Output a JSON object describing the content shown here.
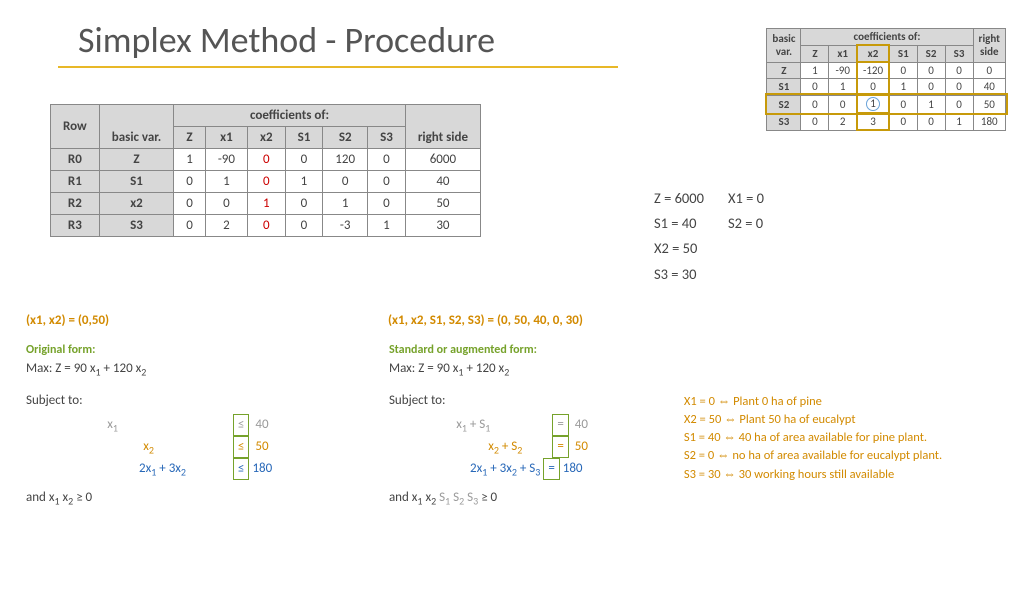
{
  "title": "Simplex Method - Procedure",
  "top_table": {
    "corner1": "basic",
    "corner2": "var.",
    "coeff_hdr": "coefficients of:",
    "right_hdr1": "right",
    "right_hdr2": "side",
    "cols": [
      "Z",
      "x1",
      "x2",
      "S1",
      "S2",
      "S3"
    ],
    "rows": [
      {
        "bv": "Z",
        "c": [
          "1",
          "-90",
          "-120",
          "0",
          "0",
          "0"
        ],
        "r": "0"
      },
      {
        "bv": "S1",
        "c": [
          "0",
          "1",
          "0",
          "1",
          "0",
          "0"
        ],
        "r": "40"
      },
      {
        "bv": "S2",
        "c": [
          "0",
          "0",
          "1",
          "0",
          "1",
          "0"
        ],
        "r": "50"
      },
      {
        "bv": "S3",
        "c": [
          "0",
          "2",
          "3",
          "0",
          "0",
          "1"
        ],
        "r": "180"
      }
    ]
  },
  "main_table": {
    "row_hdr": "Row",
    "bv_hdr": "basic var.",
    "coeff_hdr": "coefficients of:",
    "right_hdr": "right side",
    "cols": [
      "Z",
      "x1",
      "x2",
      "S1",
      "S2",
      "S3"
    ],
    "rows": [
      {
        "row": "R0",
        "bv": "Z",
        "c": [
          "1",
          "-90",
          "0",
          "0",
          "120",
          "0"
        ],
        "r": "6000"
      },
      {
        "row": "R1",
        "bv": "S1",
        "c": [
          "0",
          "1",
          "0",
          "1",
          "0",
          "0"
        ],
        "r": "40"
      },
      {
        "row": "R2",
        "bv": "x2",
        "c": [
          "0",
          "0",
          "1",
          "0",
          "1",
          "0"
        ],
        "r": "50"
      },
      {
        "row": "R3",
        "bv": "S3",
        "c": [
          "0",
          "2",
          "0",
          "0",
          "-3",
          "1"
        ],
        "r": "30"
      }
    ]
  },
  "vals": {
    "z": "Z = 6000",
    "x1": "X1 = 0",
    "s1": "S1 = 40",
    "s2": "S2 = 0",
    "x2": "X2 = 50",
    "s3": "S3 = 30"
  },
  "pt1": "(x1, x2) = (0,50)",
  "pt2": "(x1, x2, S1, S2, S3) = (0, 50, 40, 0, 30)",
  "orig": {
    "title": "Original form:",
    "max": "Max:    Z = 90 x",
    "x1": "1",
    "plus": " + 120 x",
    "x2": "2",
    "subj": "Subject to:",
    "r1a": "x",
    "r1b": "1",
    "r1c": "≤",
    "r1d": "40",
    "r2a": "x",
    "r2b": "2",
    "r2c": "≤",
    "r2d": "50",
    "r3a": "2x",
    "r3b": "1",
    "r3c": " + 3x",
    "r3d": "2",
    "r3e": "≤",
    "r3f": "180",
    "nn": "and         x",
    "n1": "1",
    "sp": "   x",
    "n2": "2",
    "ge": "                  ≥ 0"
  },
  "std": {
    "title": "Standard or augmented form:",
    "max": "Max:    Z = 90 x",
    "x1": "1",
    "plus": " + 120 x",
    "x2": "2",
    "subj": "Subject to:",
    "r1a": "x",
    "r1b": "1",
    "r1c": "     + S",
    "r1d": "1",
    "r1e": "=",
    "r1f": "40",
    "r2a": "x",
    "r2b": "2",
    "r2c": "     + S",
    "r2d": "2",
    "r2e": "=",
    "r2f": "50",
    "r3a": "2x",
    "r3b": "1",
    "r3c": " + 3x",
    "r3d": "2",
    "r3e": "          + S",
    "r3f": "3",
    "r3g": "=",
    "r3h": "180",
    "nn": "and         x",
    "n1": "1",
    "sp": "   x",
    "n2": "2",
    "ss": "  S",
    "s1": "1",
    "s2s": " S",
    "s2": "2",
    "s3s": " S",
    "s3": "3",
    "ge": "   ≥ 0"
  },
  "interp": {
    "a": "X1 = 0 ⇔ Plant 0 ha of pine",
    "b": "X2 = 50 ⇔ Plant 50 ha of eucalypt",
    "c": "S1 = 40 ⇔ 40 ha of area available for pine plant.",
    "d": "S2 = 0 ⇔ no ha of area available for eucalypt plant.",
    "e": "S3 = 30 ⇔ 30 working hours still available"
  }
}
